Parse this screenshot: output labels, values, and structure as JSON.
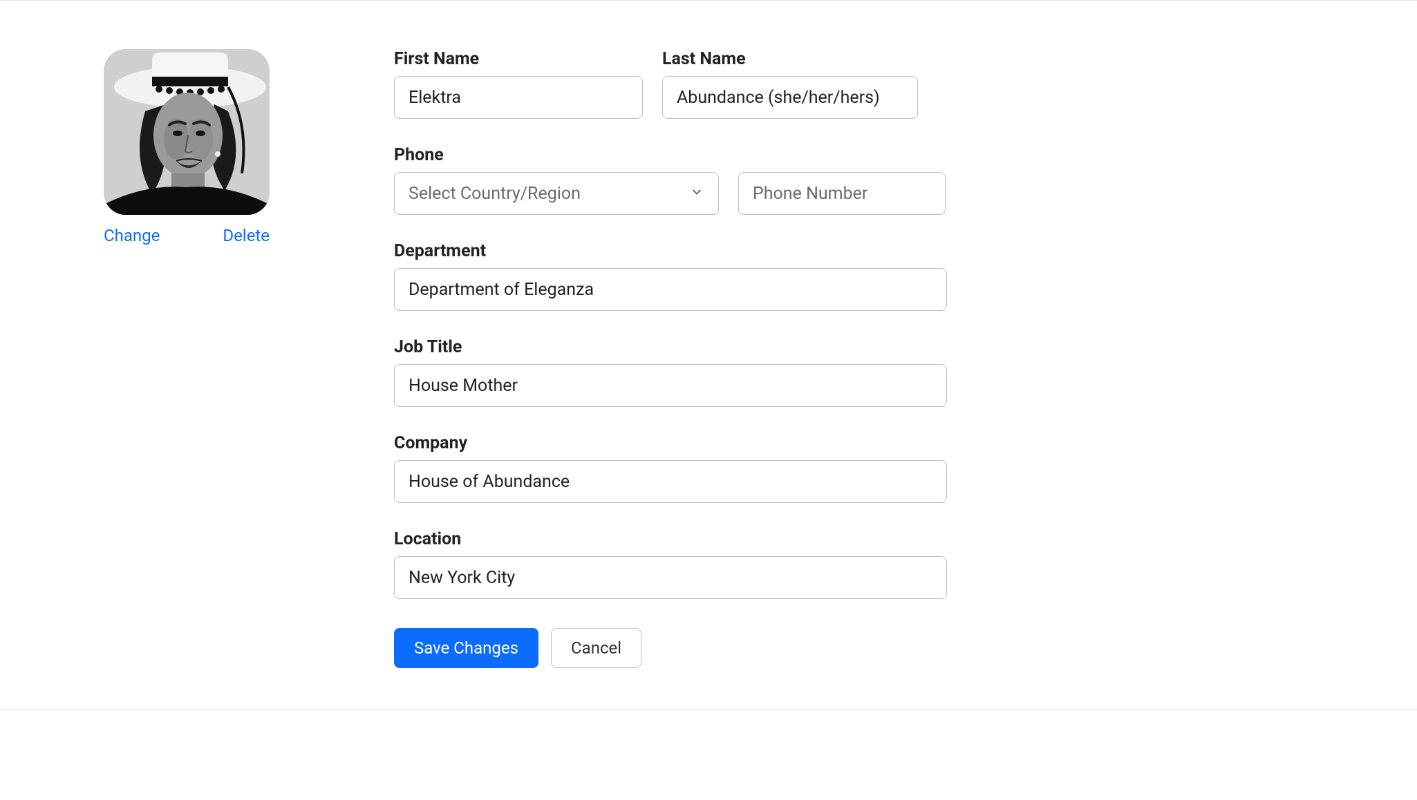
{
  "avatar": {
    "change_label": "Change",
    "delete_label": "Delete"
  },
  "form": {
    "first_name": {
      "label": "First Name",
      "value": "Elektra"
    },
    "last_name": {
      "label": "Last Name",
      "value": "Abundance (she/her/hers)"
    },
    "phone": {
      "label": "Phone",
      "region_placeholder": "Select Country/Region",
      "number_placeholder": "Phone Number"
    },
    "department": {
      "label": "Department",
      "value": "Department of Eleganza"
    },
    "job_title": {
      "label": "Job Title",
      "value": "House Mother"
    },
    "company": {
      "label": "Company",
      "value": "House of Abundance"
    },
    "location": {
      "label": "Location",
      "value": "New York City"
    }
  },
  "actions": {
    "save_label": "Save Changes",
    "cancel_label": "Cancel"
  },
  "colors": {
    "primary": "#0b6cff"
  }
}
